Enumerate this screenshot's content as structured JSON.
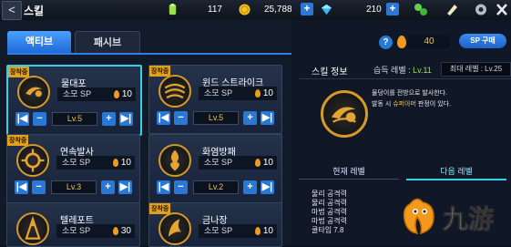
{
  "topbar": {
    "back_label": "<",
    "title": "스킬",
    "stamina": "117",
    "gold": "25,788",
    "gems": "210",
    "plus": "+"
  },
  "tabs": [
    {
      "label": "액티브",
      "active": true
    },
    {
      "label": "패시브",
      "active": false
    }
  ],
  "sp": {
    "help": "?",
    "value": "40",
    "buy_label": "SP 구매"
  },
  "skills": [
    {
      "badge": "장착중",
      "name": "물대포",
      "sp_label": "소모 SP",
      "sp": "10",
      "level": "Lv.5",
      "selected": true
    },
    {
      "badge": "장착중",
      "name": "윈드 스트라이크",
      "sp_label": "소모 SP",
      "sp": "10",
      "level": "Lv.5",
      "selected": false
    },
    {
      "badge": "장착중",
      "name": "연속발사",
      "sp_label": "소모 SP",
      "sp": "10",
      "level": "Lv.3",
      "selected": false
    },
    {
      "badge": "",
      "name": "화염방패",
      "sp_label": "소모 SP",
      "sp": "10",
      "level": "Lv.2",
      "selected": false
    },
    {
      "badge": "",
      "name": "텔레포트",
      "sp_label": "소모 SP",
      "sp": "30",
      "level": "",
      "selected": false
    },
    {
      "badge": "장착중",
      "name": "금나장",
      "sp_label": "소모 SP",
      "sp": "10",
      "level": "",
      "selected": false
    }
  ],
  "controls": {
    "first": "|◀",
    "minus": "−",
    "plus": "+",
    "last": "▶|"
  },
  "info": {
    "title": "스킬 정보",
    "acquired_label": "습득 레벨 : ",
    "acquired_value": "Lv.11",
    "max_level": "최대 레벨 : Lv.25",
    "desc_line1": "물덩이를 전방으로 발사한다.",
    "desc_line2_a": "발동 시 ",
    "desc_line2_em": "슈퍼아머",
    "desc_line2_b": " 판정이 있다.",
    "current_tab": "현재 레벨",
    "next_tab": "다음 레벨",
    "stats": [
      "물리 공격력",
      "물리 공격력",
      "마법 공격력",
      "마법 공격력",
      "쿨타임 7.8"
    ]
  },
  "colors": {
    "accent": "#2a78d6",
    "highlight": "#38d0e6",
    "gold": "#f3c24a",
    "badge": "#e0a21c"
  },
  "watermark": {
    "text": "九游"
  }
}
